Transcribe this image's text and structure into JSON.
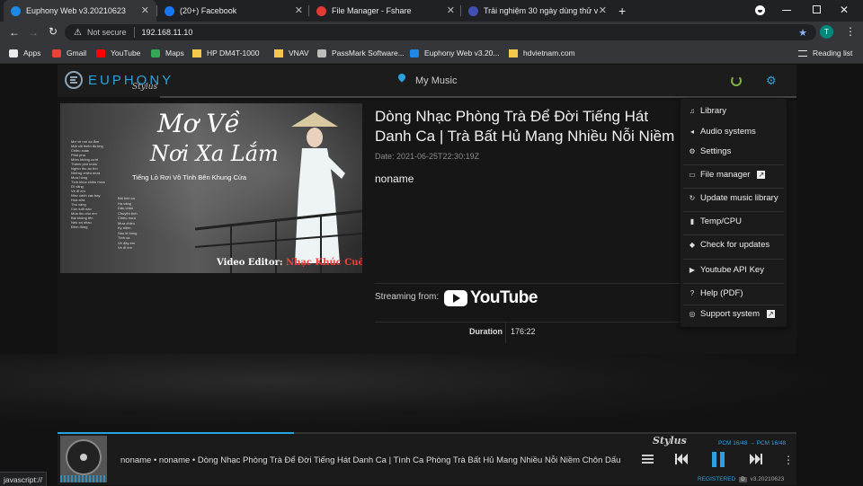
{
  "browser": {
    "tabs": [
      {
        "title": "Euphony Web v3.20210623",
        "active": true,
        "icon": "euphony-icon",
        "color": "#1e88e5"
      },
      {
        "title": "(20+) Facebook",
        "active": false,
        "icon": "facebook-icon",
        "color": "#1877f2"
      },
      {
        "title": "File Manager - Fshare",
        "active": false,
        "icon": "cloud-icon",
        "color": "#e53935"
      },
      {
        "title": "Trải nghiệm 30 ngày dùng thử v",
        "active": false,
        "icon": "forum-icon",
        "color": "#3f51b5"
      }
    ],
    "new_tab": "+",
    "address": {
      "security": "Not secure",
      "url": "192.168.11.10"
    },
    "profile_initial": "T",
    "bookmarks": [
      {
        "label": "Apps",
        "icon": "apps-grid-icon"
      },
      {
        "label": "Gmail",
        "icon": "gmail-icon"
      },
      {
        "label": "YouTube",
        "icon": "youtube-icon"
      },
      {
        "label": "Maps",
        "icon": "maps-icon"
      },
      {
        "label": "HP DM4T-1000",
        "icon": "folder-icon"
      },
      {
        "label": "VNAV",
        "icon": "folder-icon"
      },
      {
        "label": "PassMark Software...",
        "icon": "passmark-icon"
      },
      {
        "label": "Euphony Web v3.20...",
        "icon": "euphony-icon"
      },
      {
        "label": "hdvietnam.com",
        "icon": "folder-icon"
      }
    ],
    "reading_list": "Reading list",
    "status_url": "javascript://"
  },
  "app": {
    "logo_text": "EUPHONY",
    "logo_sub": "Stylus",
    "location_label": "My Music",
    "accent": "#29a3e0",
    "power_color": "#7cb342",
    "track": {
      "title": "Dòng Nhạc Phòng Trà Để Đời Tiếng Hát Danh Ca | Trà Bất Hủ Mang Nhiều Nỗi Niềm Chôn Dấu",
      "date": "Date: 2021-06-25T22:30:19Z",
      "artist": "noname",
      "streaming_label": "Streaming from:",
      "streaming_service": "YouTube",
      "duration_label": "Duration",
      "duration_value": "176:22"
    },
    "cover": {
      "title_line1": "Mơ Về",
      "title_line2": "Nơi Xa Lắm",
      "subtitle": "Tiếng Lò Rơi Vô Tình Bên Khung Cửa",
      "credit_prefix": "Video Editor: ",
      "credit_name": "Nhạc Khúc Cuối",
      "tracklist_left": [
        "Mơ về nơi xa lắm",
        "Một cõi thiên đường",
        "Chiều xuân",
        "Phôi pha",
        "Môm không cười",
        "Thành phố buồn",
        "Nghìn thu áo tím",
        "Những chiều mưa",
        "Mưa hồng",
        "Tình khúc chiều mưa",
        "Dĩ vãng",
        "Về đi em",
        "Như cánh vạc bay",
        "Hoa sữa",
        "Thu vàng",
        "Còn tuổi nào",
        "Mùa thu cho em",
        "Bài không tên",
        "Nếu xa nhau",
        "Đêm đông"
      ],
      "tracklist_right": [
        "Bài tình ca",
        "Hạ vàng",
        "Dấu chân",
        "Chuyện tình",
        "Chiều mưa",
        "Mưa chiều",
        "Kỷ niệm",
        "Sầu lẻ bóng",
        "Tình xa",
        "Về đây em",
        "Về đi em"
      ]
    },
    "menu": [
      {
        "label": "Library",
        "icon": "music-note-icon",
        "external": false
      },
      {
        "label": "Audio systems",
        "icon": "speaker-icon",
        "external": false
      },
      {
        "label": "Settings",
        "icon": "gears-icon",
        "external": false
      },
      {
        "label": "File manager",
        "icon": "folder-open-icon",
        "external": true
      },
      {
        "label": "Update music library",
        "icon": "refresh-icon",
        "external": false
      },
      {
        "label": "Temp/CPU",
        "icon": "thermometer-icon",
        "external": false
      },
      {
        "label": "Check for updates",
        "icon": "cube-icon",
        "external": false
      },
      {
        "label": "Youtube API Key",
        "icon": "youtube-small-icon",
        "external": false
      },
      {
        "label": "Help (PDF)",
        "icon": "question-icon",
        "external": false
      },
      {
        "label": "Support system",
        "icon": "lifebuoy-icon",
        "external": true
      }
    ],
    "player": {
      "now_playing": "noname • noname • Dòng Nhạc Phòng Trà Để Đời Tiếng Hát Danh Ca | Tình Ca Phòng Trà Bất Hủ Mang Nhiều Nỗi Niềm Chôn Dấu",
      "signature": "Stylus",
      "format_in": "PCM 16/48",
      "format_arrow": "→",
      "format_out": "PCM 16/48",
      "registered": "REGISTERED",
      "registered_badge": "D",
      "version": "v3.20210623",
      "progress": 0.32
    }
  }
}
